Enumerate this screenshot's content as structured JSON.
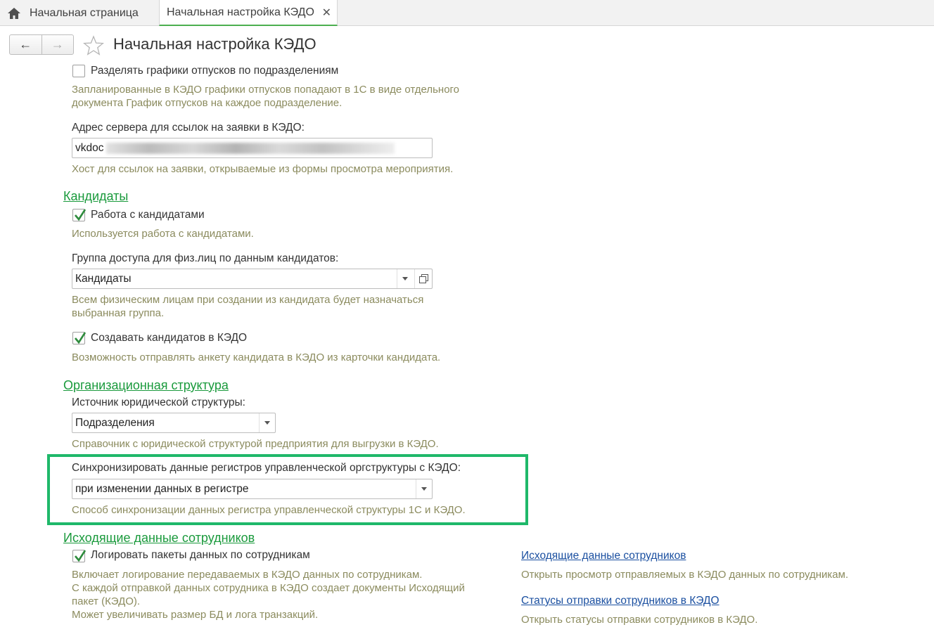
{
  "tabs": {
    "home_label": "Начальная страница",
    "active_label": "Начальная настройка КЭДО",
    "close_glyph": "✕"
  },
  "header": {
    "back_glyph": "←",
    "forward_glyph": "→",
    "title": "Начальная настройка КЭДО"
  },
  "vacation": {
    "checkbox_label": "Разделять графики отпусков по подразделениям",
    "checked": false,
    "hint_line1": "Запланированные в КЭДО графики отпусков попадают в 1С в виде отдельного",
    "hint_line2": "документа График отпусков на каждое подразделение."
  },
  "server": {
    "label": "Адрес сервера для ссылок на заявки в КЭДО:",
    "value": "vkdoc",
    "hint": "Хост для ссылок на заявки, открываемые из формы просмотра мероприятия."
  },
  "candidates": {
    "section_title": "Кандидаты",
    "work_label": "Работа с кандидатами",
    "work_checked": true,
    "work_hint": "Используется работа с кандидатами.",
    "group_label": "Группа доступа для физ.лиц по данным кандидатов:",
    "group_value": "Кандидаты",
    "group_hint_line1": "Всем физическим лицам при создании из кандидата будет назначаться",
    "group_hint_line2": "выбранная группа.",
    "create_label": "Создавать кандидатов в КЭДО",
    "create_checked": true,
    "create_hint": "Возможность отправлять анкету кандидата в КЭДО из карточки кандидата."
  },
  "org": {
    "section_title": "Организационная структура",
    "source_label": "Источник юридической структуры:",
    "source_value": "Подразделения",
    "source_hint": "Справочник с юридической структурой предприятия для выгрузки в КЭДО.",
    "sync_label": "Синхронизировать данные регистров управленческой оргструктуры с КЭДО:",
    "sync_value": "при изменении данных в регистре",
    "sync_hint": "Способ синхронизации данных регистра управленческой структуры 1С и КЭДО.",
    "highlight_color": "#1fb86a"
  },
  "outgoing": {
    "section_title": "Исходящие данные сотрудников",
    "log_label": "Логировать пакеты данных по сотрудникам",
    "log_checked": true,
    "log_hint_line1": "Включает логирование передаваемых в КЭДО данных по сотрудникам.",
    "log_hint_line2": "С каждой отправкой данных сотрудника в КЭДО создает документы Исходящий",
    "log_hint_line3": "пакет (КЭДО).",
    "log_hint_line4": "Может увеличивать размер БД и лога транзакций.",
    "link1": "Исходящие данные сотрудников",
    "link1_hint": "Открыть просмотр отправляемых в КЭДО данных по сотрудникам.",
    "link2": "Статусы отправки сотрудников в КЭДО",
    "link2_hint": "Открыть статусы отправки сотрудников в КЭДО."
  },
  "colors": {
    "section": "#1a9a3c",
    "hint": "#8b8b5e",
    "link": "#1a4fa0",
    "check": "#2e8b3d"
  },
  "icons": [
    "home-icon",
    "close-icon",
    "back-arrow-icon",
    "forward-arrow-icon",
    "star-icon",
    "checkmark-icon",
    "dropdown-arrow-icon",
    "open-form-icon"
  ]
}
